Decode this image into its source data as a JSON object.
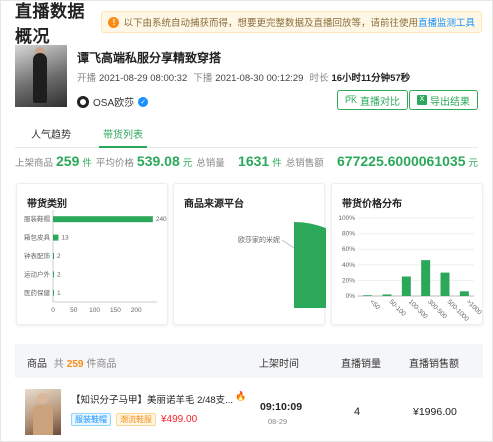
{
  "header": {
    "title": "直播数据概况",
    "notice_text": "以下由系统自动捕获而得，想要更完整数据及直播回放等，请前往使用",
    "notice_link": "直播监测工具"
  },
  "live": {
    "title": "谭飞高端私服分享精致穿搭",
    "start_label": "开播",
    "start_time": "2021-08-29 08:00:32",
    "end_label": "下播",
    "end_time": "2021-08-30 00:12:29",
    "duration_label": "时长",
    "duration": "16小时11分钟57秒",
    "author": "OSA欧莎"
  },
  "buttons": {
    "compare": "直播对比",
    "export": "导出结果"
  },
  "tabs": [
    "人气趋势",
    "带货列表"
  ],
  "stats": {
    "listed_label": "上架商品",
    "listed_value": "259",
    "listed_unit": "件",
    "avg_price_label": "平均价格",
    "avg_price_value": "539.08",
    "avg_price_unit": "元",
    "total_sales_label": "总销量",
    "total_sales_value": "1631",
    "total_sales_unit": "件",
    "total_amount_label": "总销售额",
    "total_amount_value": "677225.6000061035",
    "total_amount_unit": "元"
  },
  "cards": {
    "category_title": "带货类别",
    "source_title": "商品来源平台",
    "price_title": "带货价格分布"
  },
  "chart_data": [
    {
      "type": "bar",
      "orientation": "horizontal",
      "title": "带货类别",
      "categories": [
        "服装鞋帽",
        "箱包皮具",
        "钟表配饰",
        "运动户外",
        "医药保健"
      ],
      "values": [
        240,
        13,
        2,
        2,
        1
      ],
      "xlim": [
        0,
        250
      ],
      "xticks": [
        "0",
        "50",
        "100",
        "150",
        "200"
      ],
      "color": "#2ca85a"
    },
    {
      "type": "pie",
      "title": "商品来源平台",
      "labels": [
        "欧莎家的米妮"
      ],
      "values": [
        100
      ],
      "color": "#2ca85a"
    },
    {
      "type": "bar",
      "title": "带货价格分布",
      "categories": [
        "<50",
        "50-100",
        "100-300",
        "300-500",
        "500-1000",
        ">1000"
      ],
      "values": [
        1,
        2,
        25,
        46,
        30,
        6
      ],
      "ylim": [
        0,
        100
      ],
      "yticks": [
        "0%",
        "20%",
        "40%",
        "60%",
        "80%",
        "100%"
      ],
      "color": "#2ca85a"
    }
  ],
  "table": {
    "col_product": "商品",
    "count_prefix": "共",
    "count_value": "259",
    "count_suffix": "件商品",
    "col_time": "上架时间",
    "col_volume": "直播销量",
    "col_amount": "直播销售额",
    "rows": [
      {
        "name": "【知识分子马甲】美丽诺羊毛 2/48支...",
        "tag1": "服装鞋帽",
        "tag2": "潮流鞋服",
        "price": "¥499.00",
        "time": "09:10:09",
        "date": "08-29",
        "volume": "4",
        "amount": "¥1996.00"
      }
    ]
  }
}
